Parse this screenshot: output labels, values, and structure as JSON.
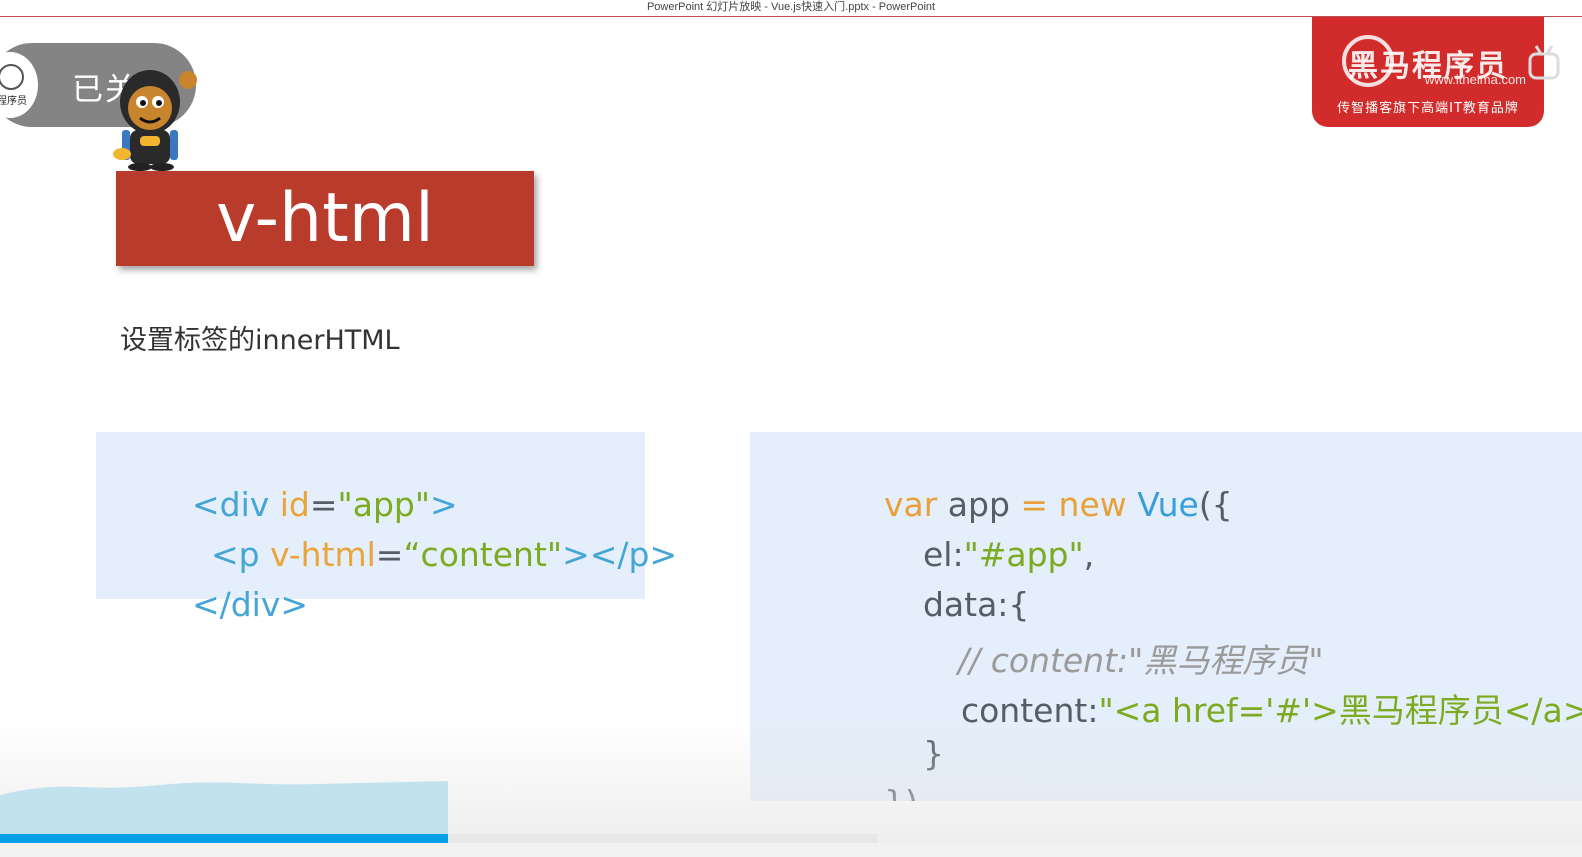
{
  "window": {
    "title": "PowerPoint 幻灯片放映  -  Vue.js快速入门.pptx - PowerPoint"
  },
  "overlay": {
    "follow_label": "已关注",
    "logo_text": "程序员"
  },
  "brand": {
    "name": "黑马程序员",
    "url": "www.itheima.com",
    "tagline": "传智播客旗下高端IT教育品牌",
    "color": "#d12b2b"
  },
  "slide": {
    "title": "v-html",
    "subtitle": "设置标签的innerHTML",
    "title_color": "#b83b2b",
    "html_code": {
      "l1_open": "<div ",
      "l1_attr": "id",
      "l1_eq": "=",
      "l1_val": "\"app\"",
      "l1_close": ">",
      "l2_open": "<p ",
      "l2_attr": "v-html",
      "l2_eq": "=",
      "l2_val": "“content\"",
      "l2_close": "></p>",
      "l3": "</div>"
    },
    "js_code": {
      "l1_var": "var",
      "l1_app": " app ",
      "l1_eq": "= ",
      "l1_new": "new ",
      "l1_vue": "Vue",
      "l1_paren": "({",
      "l2_key": "el:",
      "l2_val": "\"#app\"",
      "l2_comma": ",",
      "l3": "data:{",
      "l4_comment": "// content:\"黑马程序员\"",
      "l5_key": "content:",
      "l5_val": "\"<a href='#'>黑马程序员</a>\"",
      "l6": "}",
      "l7": "})"
    }
  },
  "playback": {
    "progress_fraction": 0.51,
    "accent": "#00a1e6"
  }
}
